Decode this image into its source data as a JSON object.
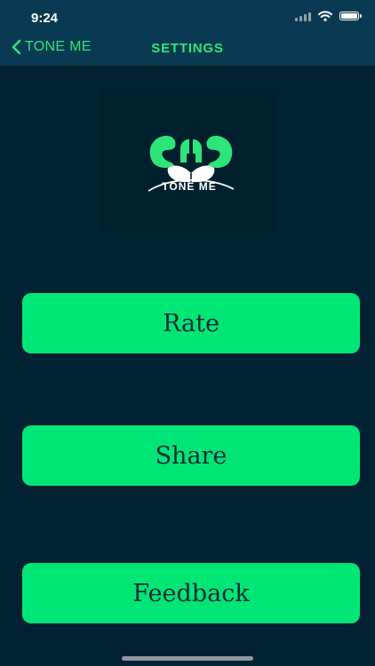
{
  "status_bar": {
    "time": "9:24",
    "icons": [
      "signal-icon",
      "wifi-icon",
      "battery-icon"
    ]
  },
  "nav": {
    "back_label": "TONE ME",
    "title": "SETTINGS"
  },
  "logo": {
    "text": "TONE ME",
    "icon": "spartan-helmet-muscles-logo"
  },
  "buttons": {
    "rate": "Rate",
    "share": "Share",
    "feedback": "Feedback"
  },
  "colors": {
    "background": "#022233",
    "nav_bar": "#0a3a52",
    "accent": "#2ee57a",
    "button": "#00e676",
    "button_text": "#0f2a36"
  }
}
